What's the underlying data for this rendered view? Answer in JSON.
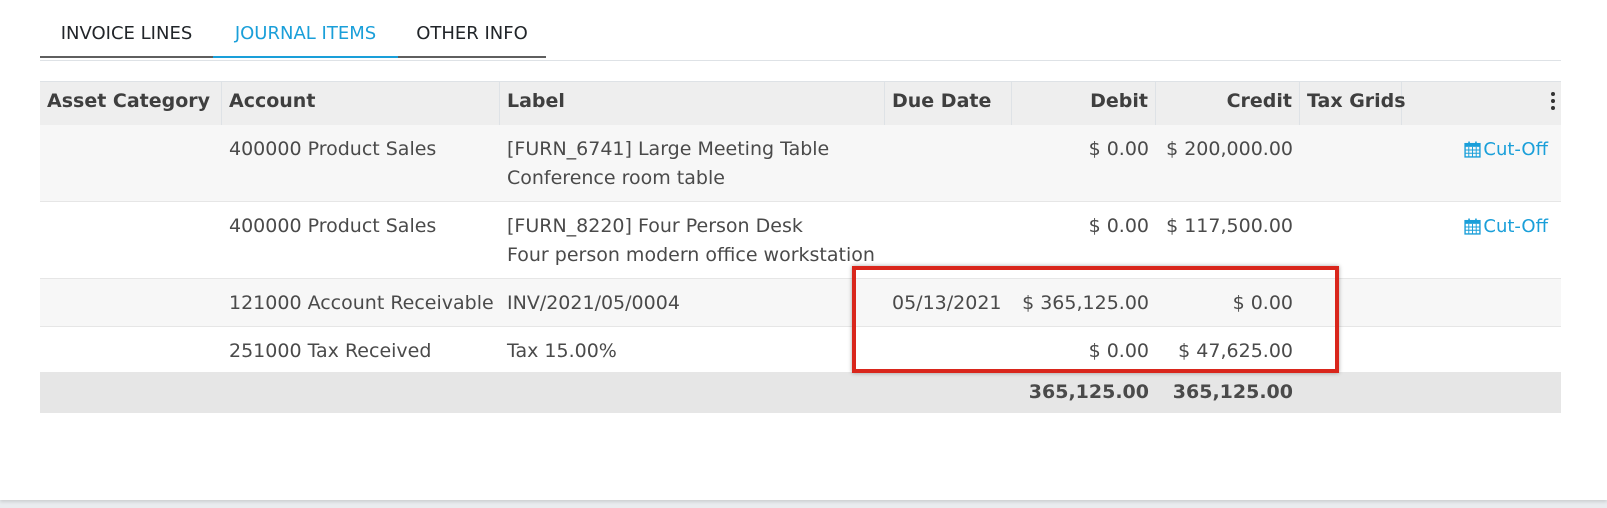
{
  "tabs": {
    "invoice_lines": "INVOICE LINES",
    "journal_items": "JOURNAL ITEMS",
    "other_info": "OTHER INFO"
  },
  "table": {
    "headers": {
      "asset_category": "Asset Category",
      "account": "Account",
      "label": "Label",
      "due_date": "Due Date",
      "debit": "Debit",
      "credit": "Credit",
      "tax_grids": "Tax Grids"
    },
    "rows": [
      {
        "asset_category": "",
        "account": "400000 Product Sales",
        "label_line1": "[FURN_6741] Large Meeting Table",
        "label_line2": "Conference room table",
        "due_date": "",
        "debit": "$ 0.00",
        "credit": "$ 200,000.00",
        "tax_grids": "",
        "action": "Cut-Off"
      },
      {
        "asset_category": "",
        "account": "400000 Product Sales",
        "label_line1": "[FURN_8220] Four Person Desk",
        "label_line2": "Four person modern office workstation",
        "due_date": "",
        "debit": "$ 0.00",
        "credit": "$ 117,500.00",
        "tax_grids": "",
        "action": "Cut-Off"
      },
      {
        "asset_category": "",
        "account": "121000 Account Receivable",
        "label_line1": "INV/2021/05/0004",
        "due_date": "05/13/2021",
        "debit": "$ 365,125.00",
        "credit": "$ 0.00",
        "tax_grids": ""
      },
      {
        "asset_category": "",
        "account": "251000 Tax Received",
        "label_line1": "Tax 15.00%",
        "due_date": "",
        "debit": "$ 0.00",
        "credit": "$ 47,625.00",
        "tax_grids": ""
      }
    ],
    "totals": {
      "debit": "365,125.00",
      "credit": "365,125.00"
    }
  },
  "icons": {
    "cut_off_icon": "calendar-icon",
    "column_options_icon": "kebab-menu-icon"
  },
  "colors": {
    "accent": "#1a9fd9",
    "highlight": "#d9261c"
  }
}
